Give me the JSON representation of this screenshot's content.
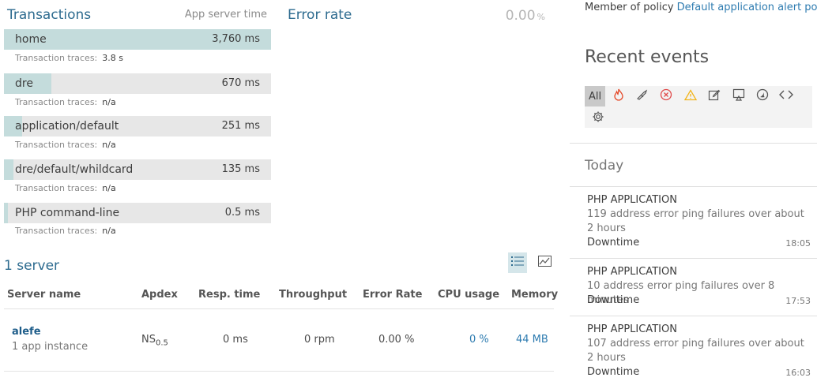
{
  "transactions": {
    "title": "Transactions",
    "column_title": "App server time",
    "trace_label": "Transaction traces:",
    "items": [
      {
        "name": "home",
        "time": "3,760 ms",
        "traces": "3.8 s",
        "fraction": 1.0
      },
      {
        "name": "dre",
        "time": "670 ms",
        "traces": "n/a",
        "fraction": 0.178
      },
      {
        "name": "application/default",
        "time": "251 ms",
        "traces": "n/a",
        "fraction": 0.067
      },
      {
        "name": "dre/default/whildcard",
        "time": "135 ms",
        "traces": "n/a",
        "fraction": 0.036
      },
      {
        "name": "PHP command-line",
        "time": "0.5 ms",
        "traces": "n/a",
        "fraction": 0.0
      }
    ]
  },
  "error_rate": {
    "title": "Error rate",
    "value": "0.00",
    "unit": "%"
  },
  "servers": {
    "title": "1 server",
    "view_icons": [
      "list-icon",
      "chart-icon"
    ],
    "columns": {
      "name": "Server name",
      "apdex": "Apdex",
      "resp": "Resp. time",
      "throughput": "Throughput",
      "error_rate": "Error Rate",
      "cpu": "CPU usage",
      "memory": "Memory"
    },
    "rows": [
      {
        "name": "alefe",
        "sub": "1 app instance",
        "apdex": "NS",
        "apdex_sub": "0.5",
        "resp": "0 ms",
        "throughput": "0 rpm",
        "error_rate": "0.00 %",
        "cpu": "0 %",
        "memory": "44 MB"
      }
    ]
  },
  "policy": {
    "prefix": "Member of policy ",
    "link": "Default application alert policy"
  },
  "recent_events": {
    "title": "Recent events",
    "filters": {
      "all_label": "All",
      "icons": [
        "fire-icon",
        "deploy-icon",
        "error-icon",
        "warning-icon",
        "note-icon",
        "screen-icon",
        "swift-icon",
        "code-icon",
        "gear-icon"
      ]
    },
    "today_label": "Today",
    "events": [
      {
        "title": "PHP APPLICATION",
        "desc": "119 address error ping failures over about 2 hours",
        "type": "Downtime",
        "time": "18:05"
      },
      {
        "title": "PHP APPLICATION",
        "desc": "10 address error ping failures over 8 minutes",
        "type": "Downtime",
        "time": "17:53"
      },
      {
        "title": "PHP APPLICATION",
        "desc": "107 address error ping failures over about 2 hours",
        "type": "Downtime",
        "time": "16:03"
      }
    ]
  },
  "colors": {
    "accent": "#2d6b8f",
    "bar_fill": "#c4dcdc",
    "bar_bg": "#e7e7e7",
    "fire": "#e54b2b",
    "error": "#e04b4b",
    "warning": "#f2b51c"
  }
}
